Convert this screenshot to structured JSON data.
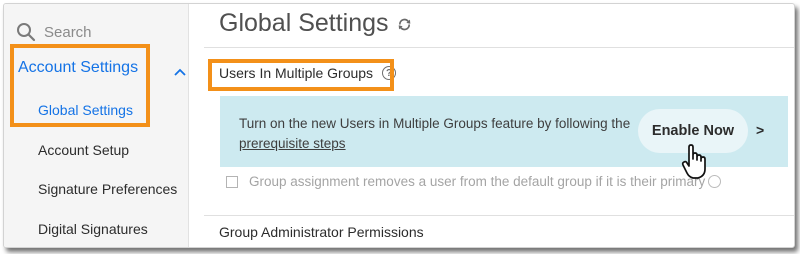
{
  "sidebar": {
    "search_placeholder": "Search",
    "section_label": "Account Settings",
    "items": [
      {
        "label": "Global Settings",
        "active": true
      },
      {
        "label": "Account Setup",
        "active": false
      },
      {
        "label": "Signature Preferences",
        "active": false
      },
      {
        "label": "Digital Signatures",
        "active": false
      }
    ]
  },
  "main": {
    "title": "Global Settings",
    "section_title": "Users In Multiple Groups",
    "banner": {
      "line1": "Turn on the new Users in Multiple Groups feature by following the",
      "link": "prerequisite steps",
      "button": "Enable Now",
      "arrow": ">"
    },
    "checkbox_label": "Group assignment removes a user from the default group if it is their primary",
    "checkbox_checked": false,
    "next_section_title": "Group Administrator Permissions"
  },
  "colors": {
    "accent": "#1473e6",
    "highlight": "#f39019",
    "banner_bg": "#cdeaf0"
  },
  "icons": [
    "search-icon",
    "chevron-up-icon",
    "refresh-icon",
    "help-icon",
    "hand-cursor-icon"
  ]
}
